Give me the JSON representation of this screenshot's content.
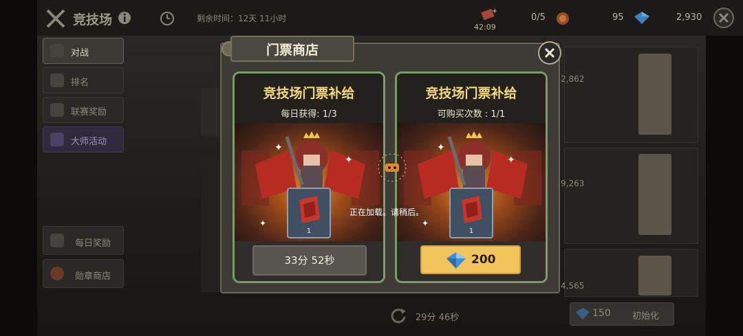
{
  "header": {
    "title": "竞技场",
    "remaining_time": "剩余时间：12天 11小时",
    "ticket_timer": "42:09",
    "ticket_count": "0/5",
    "medal_count": "95",
    "gem_count": "2,930"
  },
  "sidebar": {
    "items": [
      {
        "label": "对战",
        "active": true
      },
      {
        "label": "排名"
      },
      {
        "label": "联赛奖励"
      },
      {
        "label": "大师活动"
      }
    ],
    "extra": [
      {
        "label": "每日奖励"
      },
      {
        "label": "勋章商店"
      }
    ]
  },
  "background_panels": {
    "scores": [
      "2,862",
      "9,263",
      "4,565"
    ]
  },
  "bottom_bar": {
    "refresh_timer": "29分 46秒",
    "reset_cost": "150",
    "reset_label": "初始化"
  },
  "modal": {
    "title": "门票商店",
    "cards": [
      {
        "title": "竞技场门票补给",
        "subtitle": "每日获得: 1/3",
        "item_qty": "1",
        "button_label": "33分 52秒",
        "button_type": "timer"
      },
      {
        "title": "竞技场门票补给",
        "subtitle": "可购买次数 : 1/1",
        "item_qty": "1",
        "button_label": "200",
        "button_type": "gem-purchase"
      }
    ],
    "loading_text": "正在加载。请稍后。"
  },
  "colors": {
    "card_border": "#7f9b6a",
    "title_gold": "#f6d977",
    "buy_button": "#f1c45c",
    "gem_blue": "#4aa3e8"
  }
}
